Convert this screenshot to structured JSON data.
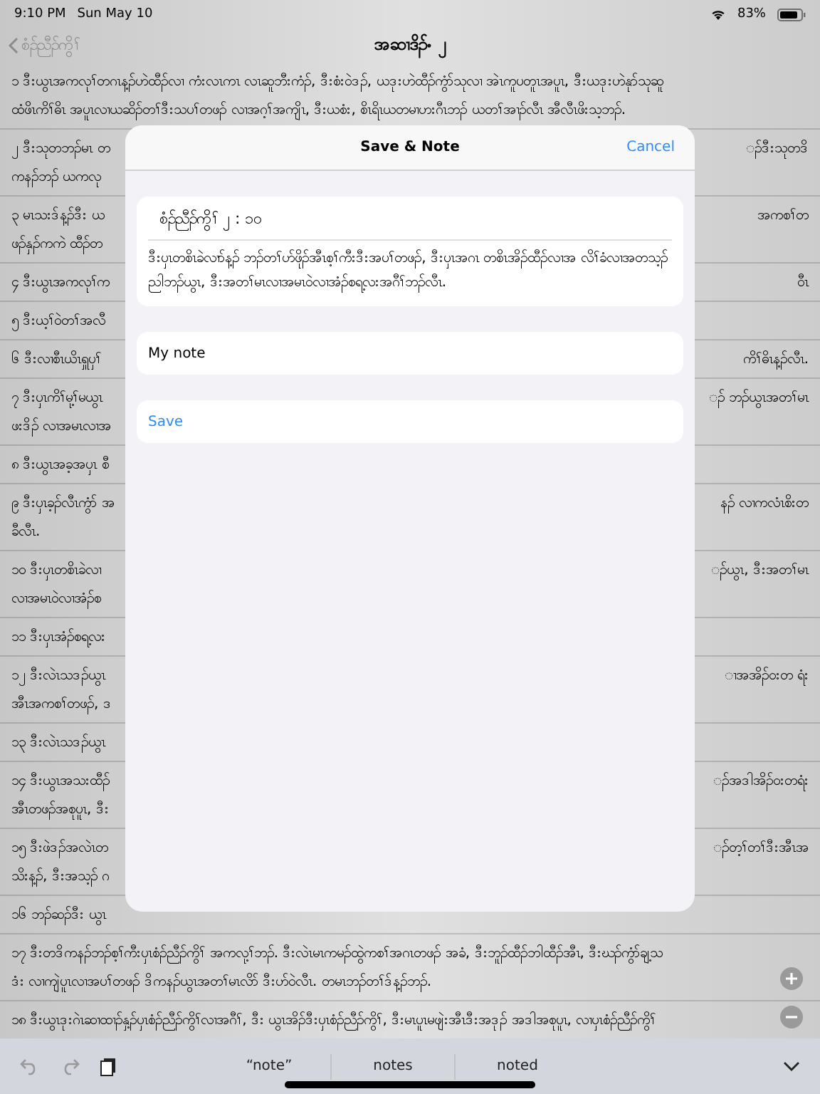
{
  "status_bar": {
    "time": "9:10 PM",
    "date": "Sun May 10",
    "battery": "83%"
  },
  "nav": {
    "back": "စံၣ်ညီၣ်ကွိၢ်",
    "title": "အဆၢဒိၣ်ႋ ၂"
  },
  "verses": [
    {
      "lines": [
        {
          "left": "၁ ဒီးယွၤအကလုၢ်တဂၤန့ၣ်ဟဲထီၣ်လၢ ကံးလၤကၤ လၤဆူဘီးကံၣ်, ဒီးစံးဝဲဒၣ်, ယဒုးဟဲထီၣ်ကွံာ်သုလၢ အဲၤကူပတူၤအပူၤ, ဒီးယဒုးဟဲနုာ်သုဆူ"
        },
        {
          "left": "ထံဖိၤကိၢ်ဓိၤ အပူၤလၢယဆိၣ်တၢ်ဒီးသပၢ်တဖၣ် လၢအဂ့ၢ်အကျိၤ, ဒီးယစံး, စိၤရိၤယတမၢဟးဂီၤဘၣ် ယတၢ်အၢၣ်လီၤ အီလီၤဖိးသ့ဘၣ်."
        }
      ]
    },
    {
      "lines": [
        {
          "left": "၂ ဒီးသုတဘၣ်မၤ တ",
          "right": "ၣ်ဒီးသုတဒိ"
        },
        {
          "left": "ကနၣ်ဘၣ် ယကလု"
        }
      ]
    },
    {
      "lines": [
        {
          "left": "၃ မၤသးဒ်န့ၣ်ဒီး ယ",
          "right": "အကစၢ်တ"
        },
        {
          "left": "ဖၣ်နှၣ်ကကဲ ထီၣ်တ"
        }
      ]
    },
    {
      "lines": [
        {
          "left": "၄ ဒီးယွၤအကလုၢ်က",
          "right": "ဝီၤ"
        }
      ]
    },
    {
      "lines": [
        {
          "left": "၅ ဒီးယ့ၢ်ဝဲတၢ်အလီ"
        }
      ]
    },
    {
      "lines": [
        {
          "left": "၆ ဒီးလၢစီၤယိၤရှူပှၢ်",
          "right": "ကိၢ်ဓိၤန့ၣ်လီၤ."
        }
      ]
    },
    {
      "lines": [
        {
          "left": "၇ ဒီးပှၤကိၢ်မု့ၢ်မယွၤ",
          "right": "ၣ် ဘၣ်ယွၤအတၢ်မၤ"
        },
        {
          "left": "ဖးဒိၣ် လၢအမၤလၢအ"
        }
      ]
    },
    {
      "lines": [
        {
          "left": "၈ ဒီးယွၤအခ့အပှၤ စီ"
        }
      ]
    },
    {
      "lines": [
        {
          "left": "၉ ဒီးပှၤခ့ၣ်လီၤကွံာ် အ",
          "right": "နၣ် လၢကလံၤစိးတ"
        },
        {
          "left": "ခီလီၤ."
        }
      ]
    },
    {
      "lines": [
        {
          "left": "၁၀ ဒီးပှၤတစိၤခဲလၢ",
          "right": "ၣ်ယွၤ, ဒီးအတၢ်မၤ"
        },
        {
          "left": "လၢအမၤဝဲလၢအံၣ်စ"
        }
      ]
    },
    {
      "lines": [
        {
          "left": "၁၁ ဒီးပှၤအံၣ်စရ့လး"
        }
      ]
    },
    {
      "lines": [
        {
          "left": "၁၂ ဒီးလဲၤသဒၣ်ယွၤ",
          "right": "ၢအအိၣ်ဝးတ ရံး"
        },
        {
          "left": "အီၤအကစၢ်တဖၣ်, ဒ"
        }
      ]
    },
    {
      "lines": [
        {
          "left": "၁၃ ဒီးလဲၤသဒၣ်ယွၤ"
        }
      ]
    },
    {
      "lines": [
        {
          "left": "၁၄ ဒီးယွၤအသးထီၣ်",
          "right": "ၣ်အဒါအိၣ်ဝးတရံး"
        },
        {
          "left": "အီၤတဖၣ်အစုပူၤ, ဒီး"
        }
      ]
    },
    {
      "lines": [
        {
          "left": "၁၅ ဒီးဖဲဒၣ်အလဲၤတ",
          "right": "ၣ်တ့ၢ်တၢ်ဒီးအီၤအ"
        },
        {
          "left": "သိးန့ၣ်, ဒီးအသ့ၣ် ဂ"
        }
      ]
    },
    {
      "lines": [
        {
          "left": "၁၆ ဘၣ်ဆၣ်ဒီး ယွၤ"
        }
      ]
    },
    {
      "lines": [
        {
          "left": "၁၇ ဒီးတဒိကနၣ်ဘၣ်စ့ၢ်ကီးပှၤစံၣ်ညီၣ်ကွိၢ် အကလု့ၢ်ဘၣ်. ဒီးလဲၤမၤကမၣ်ထွဲကစၢ်အဂၤတဖၣ် အခံ, ဒီးဘူၣ်ထီၣ်ဘါထီၣ်အီၤ, ဒီးဃၣ်ကွံာ်ချ့သ"
        },
        {
          "left": "ဒံး လၢကျဲပူၤလၢအပၢ်တဖၣ် ဒိကနၣ်ယွၤအတၢ်မၤလိာ် ဒီးဟ်ဝဲလီၤ. တမၤဘၣ်တၢ်ဒ်န့ၣ်ဘၣ်."
        }
      ]
    },
    {
      "lines": [
        {
          "left": "၁၈ ဒီးယွၤဒုးဂဲၤဆၢထၢၣ်နှ့ၣ်ပှၤစံၣ်ညီၣ်ကွိၢ်လၢအဂီၢ်, ဒီး ယွၤအိၣ်ဒီးပှၤစံၣ်ညီၣ်ကွိၢ်, ဒီးမၤပူၤမဖျဲးအီၤဒီးအဒုၣ် အဒါအစုပူၤ, လၢပှၤစံၣ်ညီၣ်ကွိၢ်"
        }
      ]
    }
  ],
  "modal": {
    "title": "Save & Note",
    "cancel": "Cancel",
    "reference": "စံၣ်ညီၣ်ကွိၢ် ၂ : ၁၀",
    "verse": "ဒီးပှၤတစိၤခဲလၢာ်န့ၣ် ဘၣ်တၢ်ဟ်ဖိုၣ်အီၤစ့ၢ်ကီးဒီးအပၢ်တဖၣ်, ဒီးပှၤအဂၤ တစိၤအိၣ်ထီၣ်လၢအ လိၢ်ခံလၢအတသ့ၣ်ညါဘၣ်ယွၤ, ဒီးအတၢ်မၤလၢအမၤဝဲလၢအံၣ်စရ့လးအဂီၢ်ဘၣ်လီၤ.",
    "note": "My note",
    "save": "Save"
  },
  "keyboard_bar": {
    "suggestions": [
      "“note”",
      "notes",
      "noted"
    ]
  }
}
